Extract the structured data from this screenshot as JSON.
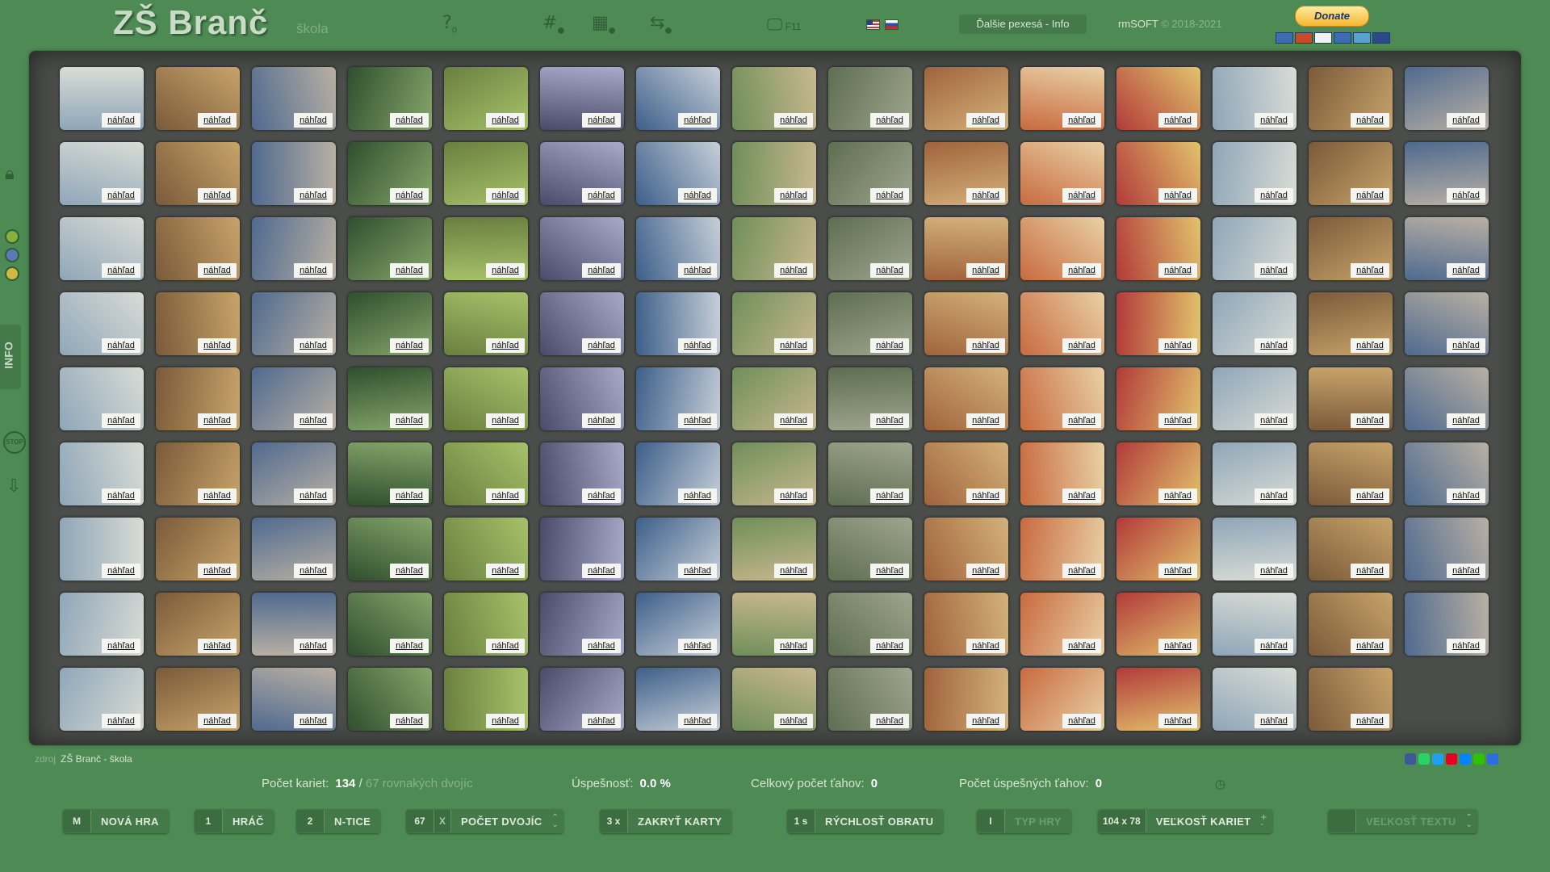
{
  "header": {
    "title": "ZŠ Branč",
    "subtitle": "škola",
    "icons": {
      "help": {
        "glyph": "?",
        "sub": "0"
      },
      "hash": {
        "glyph": "#",
        "sub": "●"
      },
      "grid": {
        "glyph": "▦",
        "sub": "●"
      },
      "swap": {
        "glyph": "⇆",
        "sub": "●"
      },
      "fullscreen": {
        "glyph": "🖵",
        "sub": "F11"
      }
    },
    "info_button": "Ďalšie pexesá - Info",
    "brand": "rmSOFT",
    "years": "© 2018-2021",
    "donate": "Donate"
  },
  "card_badge": "náhľad",
  "cards": {
    "count": 134,
    "columns": 15,
    "palette": [
      [
        "#8fa6b8",
        "#d9dcd6"
      ],
      [
        "#6f8f5a",
        "#c9b88f"
      ],
      [
        "#4f6a8f",
        "#b9b0a4"
      ],
      [
        "#a0633c",
        "#d4b27a"
      ],
      [
        "#6a7f3f",
        "#a7c26a"
      ],
      [
        "#b23a3a",
        "#e2c36c"
      ],
      [
        "#3d5f8a",
        "#c7cfd8"
      ],
      [
        "#7a5a3a",
        "#c8a46a"
      ],
      [
        "#5e6e52",
        "#9fa58e"
      ],
      [
        "#2f4f2f",
        "#86a66a"
      ],
      [
        "#c96a3f",
        "#e9d1a6"
      ],
      [
        "#4a4a6a",
        "#a9a9c9"
      ]
    ]
  },
  "footer": {
    "source_label": "zdroj",
    "source_value": "ZŠ Branč - škola"
  },
  "stats": {
    "cards_label": "Počet kariet:",
    "cards_value": "134",
    "pairs_value": "67",
    "pairs_label": "rovnakých dvojíc",
    "success_label": "Úspešnosť:",
    "success_value": "0.0 %",
    "moves_label": "Celkový počet ťahov:",
    "moves_value": "0",
    "success_moves_label": "Počet úspešných ťahov:",
    "success_moves_value": "0"
  },
  "controls": {
    "new_game": {
      "key": "M",
      "label": "NOVÁ HRA"
    },
    "player": {
      "key": "1",
      "label": "HRÁČ"
    },
    "ntice": {
      "key": "2",
      "label": "N-TICE"
    },
    "pairs": {
      "key": "67",
      "x": "X",
      "label": "POČET DVOJÍC"
    },
    "cover": {
      "key": "3 x",
      "label": "ZAKRYŤ KARTY"
    },
    "speed": {
      "key": "1 s",
      "label": "RÝCHLOSŤ OBRATU"
    },
    "type": {
      "key": "I",
      "label": "TYP HRY"
    },
    "size": {
      "key": "104 x 78",
      "label": "VEĽKOSŤ KARIET"
    },
    "text_size": {
      "key": "",
      "label": "VEĽKOSŤ TEXTU"
    }
  }
}
